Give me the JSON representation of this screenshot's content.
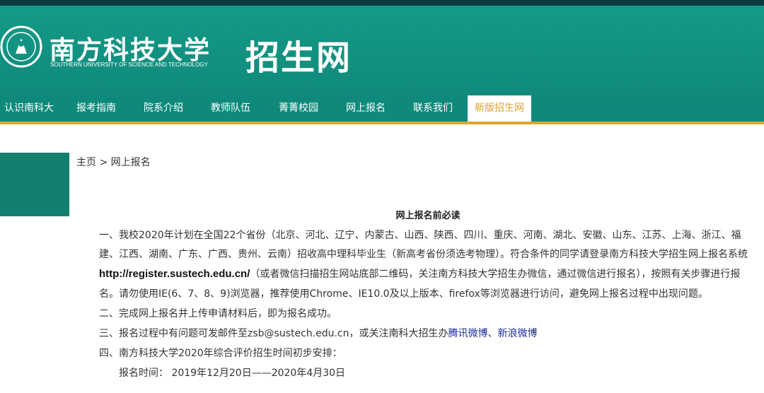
{
  "header": {
    "logo_cn": "南方科技大学",
    "logo_en": "SOUTHERN UNIVERSITY OF SCIENCE AND TECHNOLOGY",
    "site_title": "招生网"
  },
  "nav": {
    "items": [
      {
        "label": "认识南科大"
      },
      {
        "label": "报考指南"
      },
      {
        "label": "院系介绍"
      },
      {
        "label": "教师队伍"
      },
      {
        "label": "菁菁校园"
      },
      {
        "label": "网上报名"
      },
      {
        "label": "联系我们"
      },
      {
        "label": "新版招生网"
      }
    ]
  },
  "breadcrumb": "主页 > 网上报名",
  "notice": {
    "title": "网上报名前必读",
    "p1_line1": "一、我校2020年计划在全国22个省份（北京、河北、辽宁、内蒙古、山西、陕西、四川、重庆、河南、湖北、安徽、山东、江苏、上海、浙江、福",
    "p1_line2": "建、江西、湖南、广东、广西、贵州、云南）招收高中理科毕业生（新高考省份须选考物理）。符合条件的同学请登录南方科技大学招生网上报名系统",
    "p1_url": "http://register.sustech.edu.cn/",
    "p1_line3_rest": "（或者微信扫描招生网站底部二维码，关注南方科技大学招生办微信，通过微信进行报名），按照有关步骤进行报",
    "p1_line4": "名。请勿使用IE(6、7、8、9)浏览器，推荐使用Chrome、IE10.0及以上版本、firefox等浏览器进行访问，避免网上报名过程中出现问题。",
    "p2": "二、完成网上报名并上传申请材料后，即为报名成功。",
    "p3_text": "三、报名过程中有问题可发邮件至zsb@sustech.edu.cn，或关注南科大招生办",
    "p3_link1": "腾讯微博",
    "p3_sep": "、",
    "p3_link2": "新浪微博",
    "p4": "四、南方科技大学2020年综合评价招生时间初步安排：",
    "p5": "报名时间：  2019年12月20日——2020年4月30日"
  },
  "colors": {
    "header_green": "#139585",
    "nav_accent": "#e2a52e",
    "link_blue": "#1a2aa0"
  }
}
